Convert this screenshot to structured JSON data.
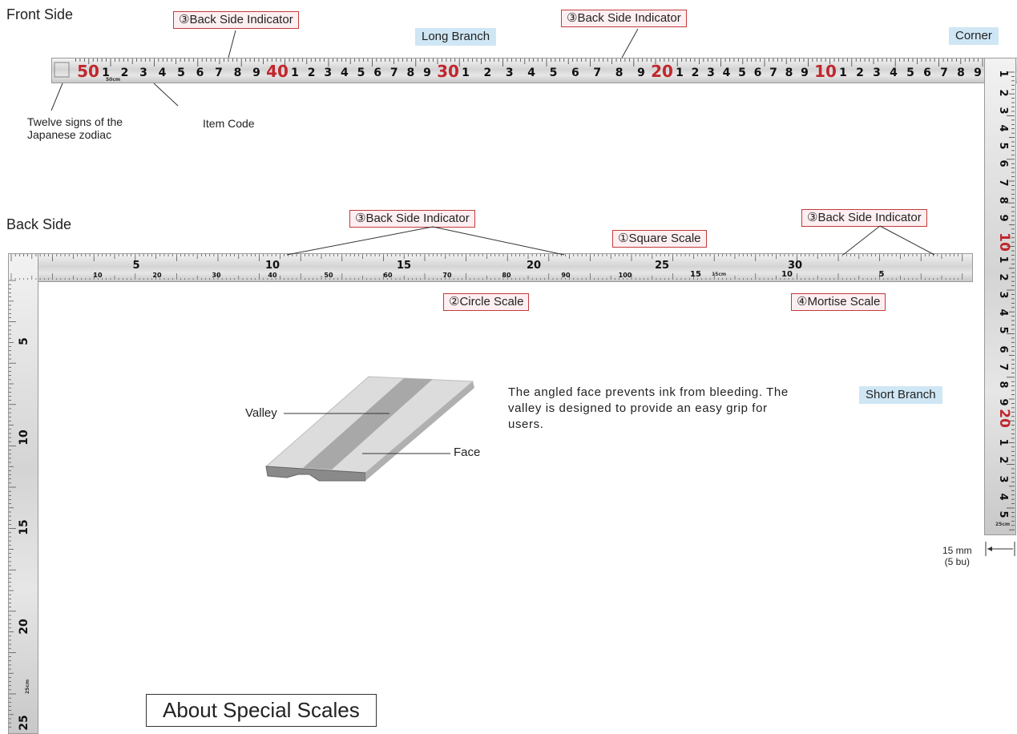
{
  "front": {
    "heading": "Front Side",
    "labels": {
      "back_indicator_1": "③Back Side Indicator",
      "back_indicator_2": "③Back Side Indicator",
      "long_branch": "Long Branch",
      "corner": "Corner",
      "zodiac": "Twelve signs of the\nJapanese zodiac",
      "item_code": "Item Code"
    },
    "long_numbers_red": [
      "50",
      "40",
      "30",
      "20",
      "10"
    ],
    "long_numbers_black": [
      "9",
      "8",
      "7",
      "6",
      "5",
      "4",
      "3",
      "2",
      "1"
    ],
    "short_numbers": [
      "1",
      "2",
      "3",
      "4",
      "5",
      "6",
      "7",
      "8",
      "9",
      "10",
      "1",
      "2",
      "3",
      "4",
      "5",
      "6",
      "7",
      "8",
      "9",
      "20",
      "1",
      "2",
      "3",
      "4",
      "5"
    ],
    "small_text": {
      "cm50": "50cm",
      "cm25": "25cm"
    }
  },
  "back": {
    "heading": "Back Side",
    "labels": {
      "back_indicator_1": "③Back Side Indicator",
      "back_indicator_2": "③Back Side Indicator",
      "square_scale": "①Square Scale",
      "circle_scale": "②Circle Scale",
      "mortise_scale": "④Mortise Scale",
      "short_branch": "Short Branch"
    },
    "top_numbers": [
      "5",
      "10",
      "15",
      "20",
      "25",
      "30"
    ],
    "circle_numbers": [
      "10",
      "20",
      "30",
      "40",
      "50",
      "60",
      "70",
      "80",
      "90",
      "100"
    ],
    "mortise_numbers": [
      "15",
      "10",
      "5"
    ],
    "vertical_numbers": [
      "5",
      "10",
      "15",
      "20",
      "25"
    ],
    "small_text": {
      "cm15": "15cm",
      "cm25": "25cm"
    }
  },
  "cross_section": {
    "valley": "Valley",
    "face": "Face",
    "description": "The angled face prevents ink from bleeding. The valley is designed to provide an easy grip for users."
  },
  "width_note": {
    "line1": "15 mm",
    "line2": "(5 bu)"
  },
  "title": "About Special Scales",
  "colors": {
    "red_numeral": "#c0272d",
    "pink_label_bg": "#fdeff1",
    "blue_label_bg": "#cfe6f4",
    "ruler_steel": "#d8d8d8"
  }
}
